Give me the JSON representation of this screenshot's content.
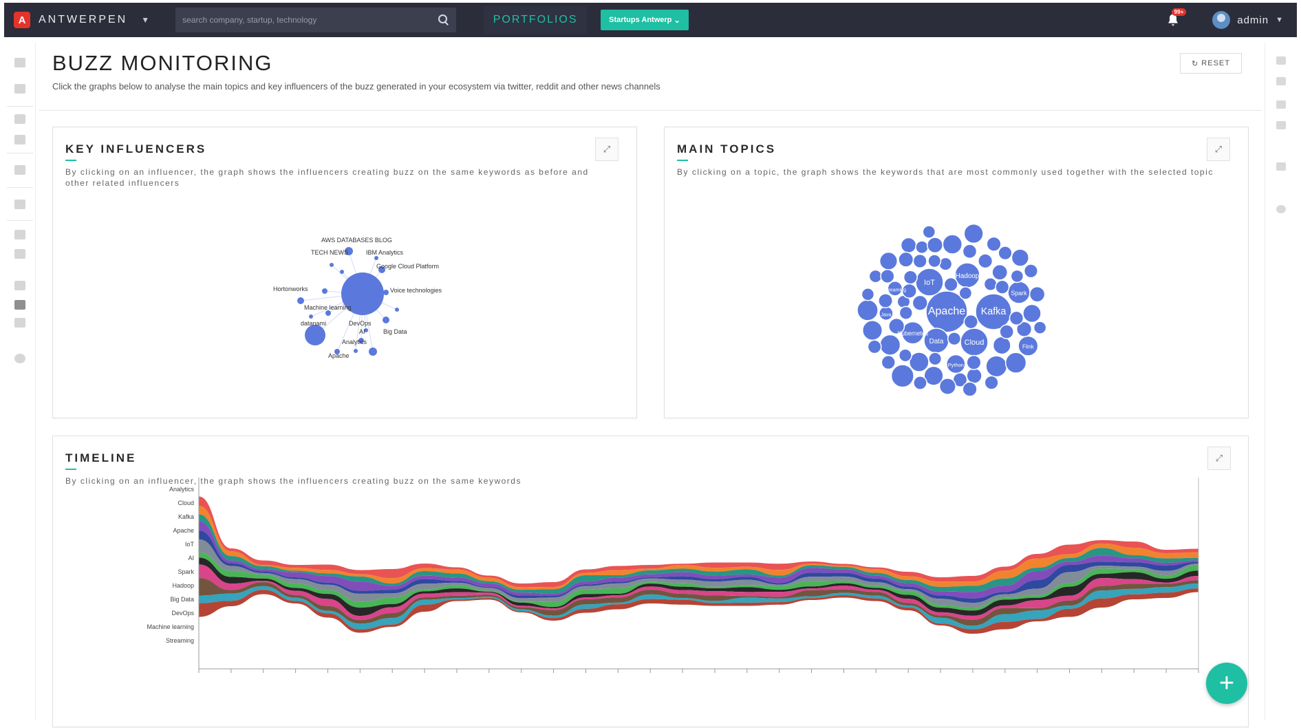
{
  "app": {
    "name": "ANTWERPEN",
    "search_placeholder": "search company, startup, technology",
    "portfolios_label": "PORTFOLIOS",
    "startups_button": "Startups Antwerp",
    "notification_count": "99+",
    "user_name": "admin"
  },
  "page": {
    "title": "BUZZ MONITORING",
    "subtitle": "Click the graphs below to analyse the main topics and key influencers of the buzz generated in your ecosystem via twitter, reddit and other news channels",
    "reset_label": "RESET"
  },
  "colors": {
    "accent": "#1fbfa4",
    "topbar": "#2b2d3a",
    "bubble": "#5b79dc",
    "alert": "#e5332a"
  },
  "icons": {
    "logo": "antwerpen-logo-icon",
    "search": "search-icon",
    "bell": "bell-icon",
    "avatar": "user-avatar-icon",
    "expand": "expand-icon",
    "add": "plus-icon"
  },
  "influencers": {
    "title": "KEY INFLUENCERS",
    "description": "By clicking on an influencer, the graph shows the influencers creating buzz on the same keywords as before and other related influencers",
    "labels": [
      "AWS DATABASES BLOG",
      "TECH NEWS",
      "IBM Analytics",
      "Google Cloud Platform",
      "Voice technologies",
      "Hortonworks",
      "Machine learning",
      "DevOps",
      "Big Data",
      "datanami",
      "Analytics",
      "AI",
      "Apache"
    ]
  },
  "topics": {
    "title": "MAIN TOPICS",
    "description": "By clicking on a topic, the graph shows the keywords that are most commonly used together with the selected topic",
    "labels": [
      "Apache",
      "Kafka",
      "IoT",
      "Spark",
      "Hadoop",
      "Cloud",
      "Data",
      "Java",
      "Python",
      "Flink",
      "Kubernetes",
      "Streaming"
    ]
  },
  "timeline": {
    "title": "TIMELINE",
    "description": "By clicking on an influencer, the graph shows the influencers creating buzz on the same keywords",
    "layers": [
      {
        "name": "Analytics",
        "color": "#e84a4a"
      },
      {
        "name": "Cloud",
        "color": "#f07c24"
      },
      {
        "name": "Kafka",
        "color": "#1e8f7e"
      },
      {
        "name": "Apache",
        "color": "#7a43b6"
      },
      {
        "name": "IoT",
        "color": "#243e9b"
      },
      {
        "name": "AI",
        "color": "#7a8694"
      },
      {
        "name": "Spark",
        "color": "#3fb14d"
      },
      {
        "name": "Hadoop",
        "color": "#1b1b1b"
      },
      {
        "name": "Big Data",
        "color": "#d63b83"
      },
      {
        "name": "DevOps",
        "color": "#6b4c35"
      },
      {
        "name": "Machine learning",
        "color": "#2a9fb8"
      },
      {
        "name": "Streaming",
        "color": "#b23a2a"
      }
    ]
  }
}
